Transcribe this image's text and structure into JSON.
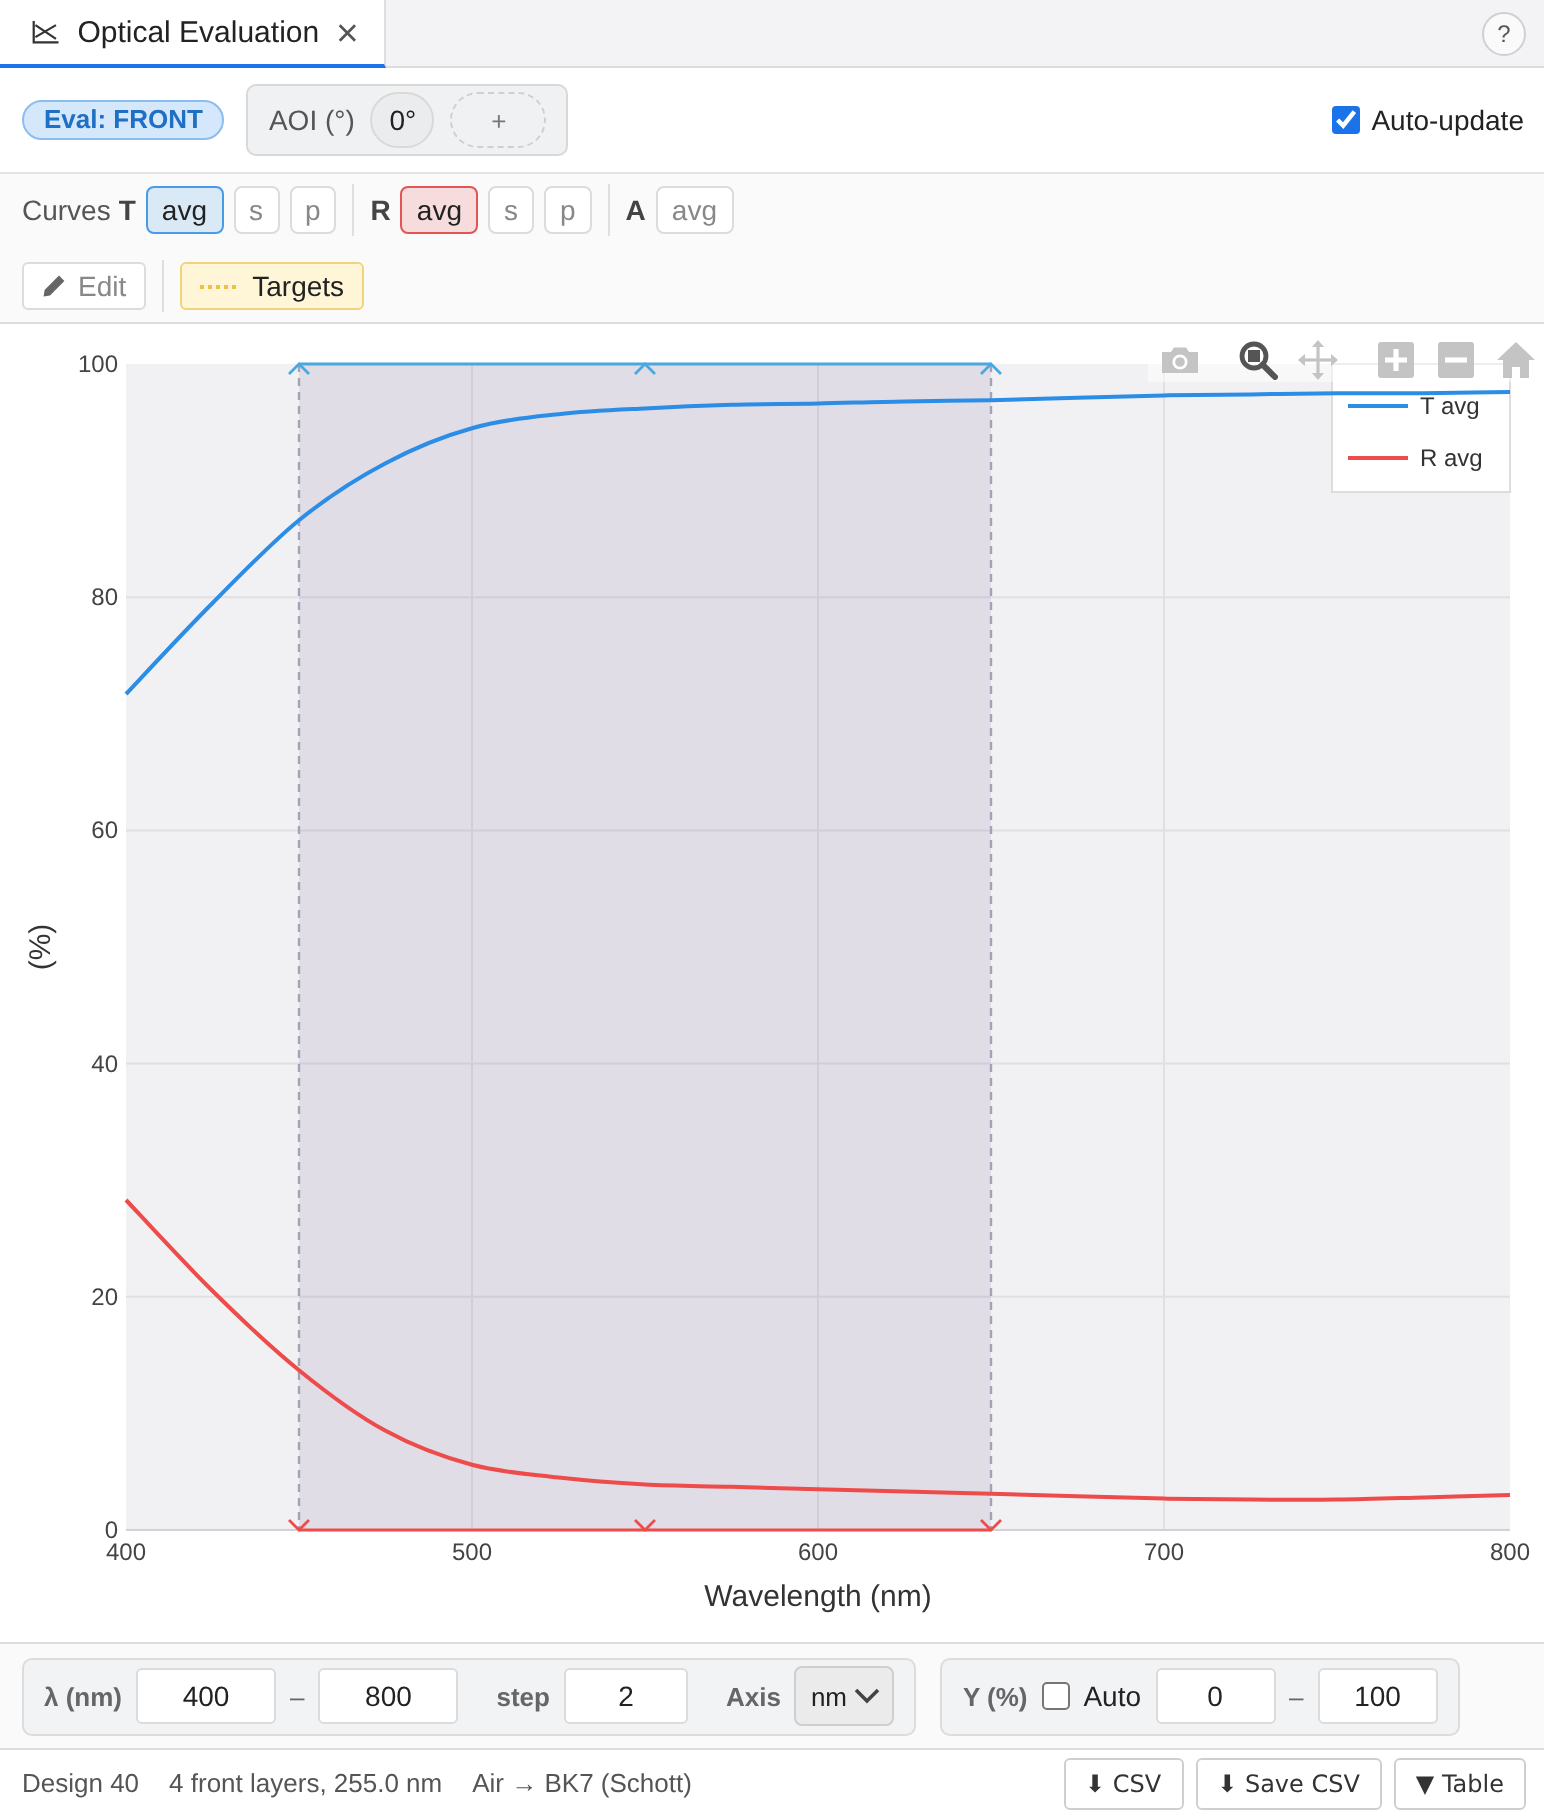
{
  "tab": {
    "title": "Optical Evaluation",
    "selected": true
  },
  "help": "?",
  "toolbar": {
    "eval_badge": "Eval: FRONT",
    "aoi": {
      "label": "AOI (°)",
      "angles": [
        {
          "label": "0°"
        }
      ],
      "add": "+"
    },
    "auto_update": {
      "label": "Auto-update",
      "checked": true
    }
  },
  "curves": {
    "label": "Curves",
    "groups": [
      {
        "label": "T",
        "color": "#4a9be6",
        "options": [
          {
            "label": "avg",
            "selected": true
          },
          {
            "label": "s",
            "selected": false
          },
          {
            "label": "p",
            "selected": false
          }
        ]
      },
      {
        "label": "R",
        "color": "#e25555",
        "options": [
          {
            "label": "avg",
            "selected": true
          },
          {
            "label": "s",
            "selected": false
          },
          {
            "label": "p",
            "selected": false
          }
        ]
      },
      {
        "label": "A",
        "options": [
          {
            "label": "avg",
            "selected": false
          }
        ]
      }
    ]
  },
  "actions": [
    {
      "kind": "edit",
      "label": "Edit",
      "disabled": true
    },
    {
      "kind": "targets",
      "label": "Targets",
      "selected": true
    }
  ],
  "modebar": [
    {
      "kind": "camera",
      "selected": false
    },
    {
      "kind": "zoom",
      "selected": true
    },
    {
      "kind": "pan",
      "selected": false
    },
    {
      "kind": "zoom_in",
      "selected": false
    },
    {
      "kind": "zoom_out",
      "selected": false
    },
    {
      "kind": "reset",
      "selected": false
    }
  ],
  "chart_data": {
    "type": "line",
    "xlabel": "Wavelength (nm)",
    "ylabel": "(%)",
    "x": [
      400,
      425,
      450,
      475,
      500,
      525,
      550,
      575,
      600,
      625,
      650,
      675,
      700,
      725,
      750,
      775,
      800
    ],
    "series": [
      {
        "name": "T avg",
        "color": "#2b8de6",
        "values": [
          71.7,
          79.5,
          86.6,
          91.5,
          94.5,
          95.7,
          96.2,
          96.5,
          96.6,
          96.8,
          96.9,
          97.1,
          97.3,
          97.4,
          97.5,
          97.5,
          97.6
        ]
      },
      {
        "name": "R avg",
        "color": "#ee4b4b",
        "values": [
          28.3,
          20.5,
          13.7,
          8.5,
          5.6,
          4.5,
          3.9,
          3.7,
          3.5,
          3.3,
          3.1,
          2.9,
          2.7,
          2.6,
          2.6,
          2.8,
          3.0
        ]
      }
    ],
    "xlim": [
      400,
      800
    ],
    "ylim": [
      0,
      100
    ],
    "xticks": [
      400,
      500,
      600,
      700,
      800
    ],
    "yticks": [
      0,
      20,
      40,
      60,
      80,
      100
    ],
    "grid": true,
    "legend": "upper right",
    "bands": [
      {
        "axis": "x",
        "from": 450,
        "to": 650
      }
    ],
    "ref_lines": [
      {
        "axis": "x",
        "value": 450,
        "color": "#a3a3b8"
      },
      {
        "axis": "x",
        "value": 650,
        "color": "#a3a3b8"
      },
      {
        "axis": "y",
        "value": 100,
        "color": "#4aa8e0"
      },
      {
        "axis": "y",
        "value": 0,
        "color": "#ee4b4b"
      }
    ]
  },
  "range": {
    "label": "λ (nm)",
    "from": "400",
    "separator": "–",
    "to": "800",
    "step": {
      "label": "step",
      "value": "2"
    },
    "axis": {
      "label": "Axis",
      "value": "nm"
    }
  },
  "y_range": {
    "label": "Y (%)",
    "auto": {
      "label": "Auto",
      "checked": false
    },
    "from": "0",
    "separator": "–",
    "to": "100"
  },
  "status_bar": {
    "items": [
      "Design 40",
      "4 front layers, 255.0 nm",
      "Air → BK7 (Schott)"
    ],
    "buttons": [
      "⬇ CSV",
      "⬇ Save CSV",
      "▼ Table"
    ]
  }
}
